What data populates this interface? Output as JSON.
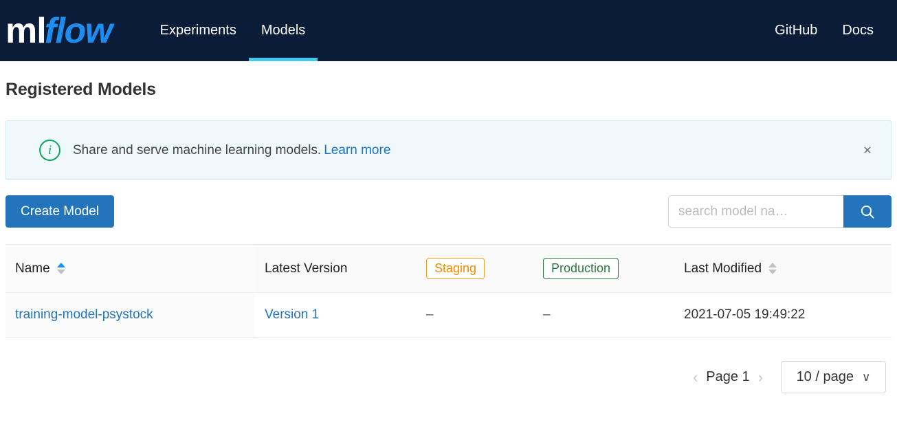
{
  "navbar": {
    "brand": {
      "part1": "ml",
      "part2": "flow"
    },
    "tabs": [
      {
        "label": "Experiments",
        "active": false
      },
      {
        "label": "Models",
        "active": true
      }
    ],
    "links": [
      {
        "label": "GitHub"
      },
      {
        "label": "Docs"
      }
    ]
  },
  "page": {
    "title": "Registered Models"
  },
  "alert": {
    "icon": "info-circle-icon",
    "text": "Share and serve machine learning models.",
    "link_label": "Learn more",
    "close_label": "✕",
    "accent_color": "#11a65f",
    "background_color": "#eff9fb"
  },
  "toolbar": {
    "create_label": "Create Model",
    "create_color": "#2374bb",
    "search": {
      "value": "",
      "placeholder": "search model na…",
      "button_icon": "search-icon"
    }
  },
  "table": {
    "columns": [
      {
        "key": "name",
        "label": "Name",
        "sortable": true,
        "sort": "asc"
      },
      {
        "key": "version",
        "label": "Latest Version",
        "sortable": false,
        "sort": "none"
      },
      {
        "key": "staging",
        "label": "Staging",
        "badge": true,
        "badge_color": "#f38b00",
        "sortable": false,
        "sort": "none"
      },
      {
        "key": "production",
        "label": "Production",
        "badge": true,
        "badge_color": "#2c7a3f",
        "sortable": false,
        "sort": "none"
      },
      {
        "key": "modified",
        "label": "Last Modified",
        "sortable": true,
        "sort": "none"
      }
    ],
    "rows": [
      {
        "name": "training-model-psystock",
        "version": "Version 1",
        "staging": "–",
        "production": "–",
        "modified": "2021-07-05 19:49:22"
      }
    ]
  },
  "pagination": {
    "prev_icon": "chevron-left-icon",
    "next_icon": "chevron-right-icon",
    "page_label": "Page 1",
    "page_size_label": "10 / page",
    "page_size_icon": "chevron-down-icon"
  }
}
